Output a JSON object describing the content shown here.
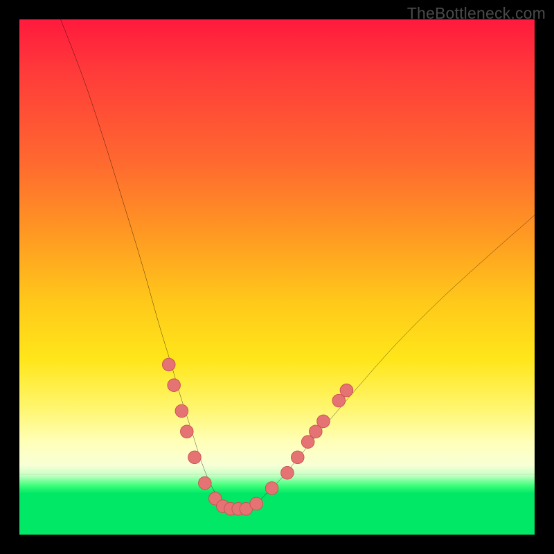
{
  "watermark": "TheBottleneck.com",
  "colors": {
    "frame": "#000000",
    "curve": "#000000",
    "marker_fill": "#e57373",
    "marker_stroke": "#c94f4f",
    "gradient_top": "#ff1a3d",
    "gradient_bottom": "#00e865"
  },
  "chart_data": {
    "type": "line",
    "title": "",
    "xlabel": "",
    "ylabel": "",
    "xlim": [
      0,
      100
    ],
    "ylim": [
      0,
      100
    ],
    "grid": false,
    "legend": false,
    "series": [
      {
        "name": "bottleneck-curve",
        "x": [
          8,
          12,
          16,
          20,
          24,
          27,
          29.5,
          31.5,
          33.5,
          35,
          36.5,
          38,
          39.5,
          41,
          42.5,
          44,
          46,
          48,
          51,
          55,
          60,
          66,
          73,
          82,
          92,
          100
        ],
        "y": [
          100,
          90,
          78,
          65,
          52,
          41,
          33,
          26,
          20,
          15,
          11,
          8,
          6,
          5,
          5,
          5,
          6,
          8,
          11,
          16,
          22,
          29,
          37,
          46,
          55,
          62
        ]
      }
    ],
    "markers": {
      "name": "highlight-dots",
      "points": [
        {
          "x": 29.0,
          "y": 33
        },
        {
          "x": 30.0,
          "y": 29
        },
        {
          "x": 31.5,
          "y": 24
        },
        {
          "x": 32.5,
          "y": 20
        },
        {
          "x": 34.0,
          "y": 15
        },
        {
          "x": 36.0,
          "y": 10
        },
        {
          "x": 38.0,
          "y": 7
        },
        {
          "x": 39.5,
          "y": 5.5
        },
        {
          "x": 41.0,
          "y": 5
        },
        {
          "x": 42.5,
          "y": 5
        },
        {
          "x": 44.0,
          "y": 5
        },
        {
          "x": 46.0,
          "y": 6
        },
        {
          "x": 49.0,
          "y": 9
        },
        {
          "x": 52.0,
          "y": 12
        },
        {
          "x": 54.0,
          "y": 15
        },
        {
          "x": 56.0,
          "y": 18
        },
        {
          "x": 57.5,
          "y": 20
        },
        {
          "x": 59.0,
          "y": 22
        },
        {
          "x": 62.0,
          "y": 26
        },
        {
          "x": 63.5,
          "y": 28
        }
      ]
    }
  }
}
